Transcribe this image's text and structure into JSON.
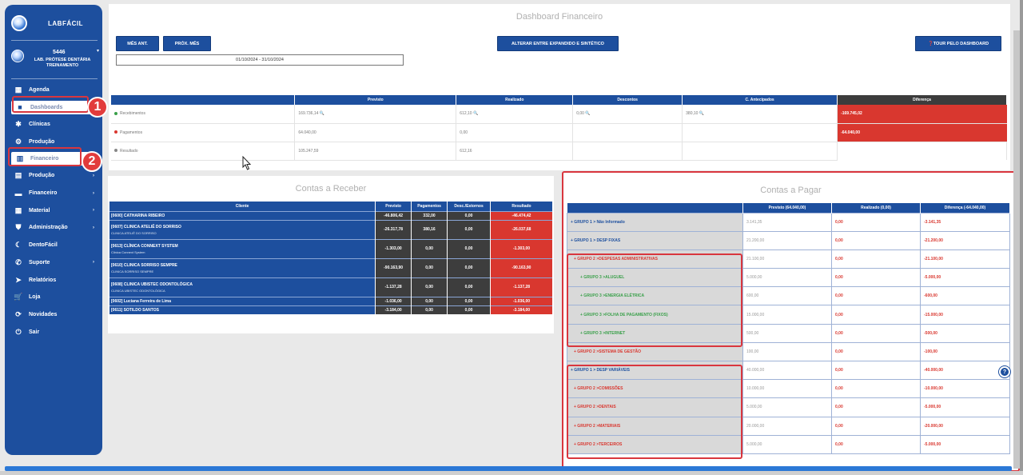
{
  "sidebar": {
    "app_name": "LABFÁCIL",
    "user": {
      "id": "5446",
      "name": "LAB. PRÓTESE DENTÁRIA TREINAMENTO"
    },
    "items": [
      {
        "label": "Agenda",
        "icon": "calendar-icon",
        "glyph": "▦"
      },
      {
        "label": "Dashboards",
        "icon": "grid-icon",
        "glyph": "■"
      },
      {
        "label": "Clínicas",
        "icon": "star-icon",
        "glyph": "✱"
      },
      {
        "label": "Produção",
        "icon": "gear-icon",
        "glyph": "⚙"
      },
      {
        "label": "Financeiro",
        "icon": "building-icon",
        "glyph": "▥"
      },
      {
        "label": "Produção",
        "icon": "chart-icon",
        "glyph": "▤"
      },
      {
        "label": "Financeiro",
        "icon": "money-icon",
        "glyph": "▬"
      },
      {
        "label": "Material",
        "icon": "box-icon",
        "glyph": "▦"
      },
      {
        "label": "Administração",
        "icon": "shield-icon",
        "glyph": "⛊"
      },
      {
        "label": "DentoFácil",
        "icon": "tooth-icon",
        "glyph": "☾"
      },
      {
        "label": "Suporte",
        "icon": "phone-icon",
        "glyph": "✆"
      },
      {
        "label": "Relatórios",
        "icon": "paper-plane-icon",
        "glyph": "➤"
      },
      {
        "label": "Loja",
        "icon": "cart-icon",
        "glyph": "🛒"
      },
      {
        "label": "Novidades",
        "icon": "refresh-icon",
        "glyph": "⟳"
      },
      {
        "label": "Sair",
        "icon": "power-icon",
        "glyph": "⏻"
      }
    ]
  },
  "annotations": {
    "one": "1",
    "two": "2"
  },
  "dashboard": {
    "title": "Dashboard Financeiro",
    "btn_prev": "MÊS ANT.",
    "btn_next": "PRÓX. MÊS",
    "btn_toggle": "ALTERAR ENTRE EXPANDIDO E SINTÉTICO",
    "btn_tour": "❓TOUR PELO DASHBOARD",
    "date_range": "01/10/2024 - 31/10/2024"
  },
  "summary": {
    "headers": [
      "",
      "Previsto",
      "Realizado",
      "Descontos",
      "C. Antecipados",
      "Diferença"
    ],
    "rows": [
      {
        "label": "Recebimentos",
        "dot": "#3aa04a",
        "previsto": "169.736,14",
        "realizado": "612,10",
        "descontos": "0,00",
        "antecipados": "380,10",
        "diferenca": "-169.745,02"
      },
      {
        "label": "Pagamentos",
        "dot": "#d9372f",
        "previsto": "64.040,00",
        "realizado": "0,00",
        "descontos": "",
        "antecipados": "",
        "diferenca": "-64.040,00"
      },
      {
        "label": "Resultado",
        "dot": "#888888",
        "previsto": "105.247,59",
        "realizado": "612,16",
        "descontos": "",
        "antecipados": "",
        "diferenca": ""
      }
    ]
  },
  "receber": {
    "title": "Contas a Receber",
    "headers": [
      "Cliente",
      "Previsto",
      "Pagamentos",
      "Desc./Estornos",
      "Resultado"
    ],
    "rows": [
      {
        "cliente": "[0600] CATHARINA RIBEIRO",
        "sub": "",
        "previsto": "-46.806,42",
        "pagamentos": "332,00",
        "desc": "0,00",
        "resultado": "-46.474,42"
      },
      {
        "cliente": "[0607] CLINICA ATELIÊ DO SORRISO",
        "sub": "CLINICA ATELIÊ DO SORRISO",
        "previsto": "-26.317,78",
        "pagamentos": "380,16",
        "desc": "0,00",
        "resultado": "-26.037,68"
      },
      {
        "cliente": "[0613] CLÍNICA CONNEXT SYSTEM",
        "sub": "Clinica Connext System",
        "previsto": "-1.303,00",
        "pagamentos": "0,00",
        "desc": "0,00",
        "resultado": "-1.303,00"
      },
      {
        "cliente": "[0610] CLINICA SORRISO SEMPRE",
        "sub": "CLINICA SORRISO SEMPRE",
        "previsto": "-90.163,90",
        "pagamentos": "0,00",
        "desc": "0,00",
        "resultado": "-90.163,90"
      },
      {
        "cliente": "[0608] CLINICA UBISTEC ODONTOLÓGICA",
        "sub": "CLINICA UBISTEC ODONTOLÓGICA",
        "previsto": "-1.137,28",
        "pagamentos": "0,00",
        "desc": "0,00",
        "resultado": "-1.137,28"
      },
      {
        "cliente": "[0602] Luciana Ferreira de Lima",
        "sub": "",
        "previsto": "-1.036,00",
        "pagamentos": "0,00",
        "desc": "0,00",
        "resultado": "-1.036,00"
      },
      {
        "cliente": "[0611] SOTILDO SANTOS",
        "sub": "",
        "previsto": "-3.184,00",
        "pagamentos": "0,00",
        "desc": "0,00",
        "resultado": "-3.184,00"
      }
    ]
  },
  "pagar": {
    "title": "Contas a Pagar",
    "headers": [
      "",
      "Previsto (64.040,00)",
      "Realizado (0,00)",
      "Diferença (-64.040,00)"
    ],
    "rows": [
      {
        "grupo": "+ GRUPO 1 > Não Informado",
        "tone": "blue",
        "level": 1,
        "previsto": "3.141,35",
        "realizado": "0,00",
        "diferenca": "-3.141,35"
      },
      {
        "grupo": "+ GRUPO 1 > DESP FIXAS",
        "tone": "blue",
        "level": 1,
        "previsto": "21.200,00",
        "realizado": "0,00",
        "diferenca": "-21.200,00"
      },
      {
        "grupo": "+ GRUPO 2 >DESPESAS ADMINISTRATIVAS",
        "tone": "red",
        "level": 2,
        "previsto": "21.100,00",
        "realizado": "0,00",
        "diferenca": "-21.100,00"
      },
      {
        "grupo": "+ GRUPO 3 >ALUGUEL",
        "tone": "green",
        "level": 3,
        "previsto": "5.000,00",
        "realizado": "0,00",
        "diferenca": "-5.000,00"
      },
      {
        "grupo": "+ GRUPO 3 >ENERGIA ELÉTRICA",
        "tone": "green",
        "level": 3,
        "previsto": "600,00",
        "realizado": "0,00",
        "diferenca": "-600,00"
      },
      {
        "grupo": "+ GRUPO 3 >FOLHA DE PAGAMENTO (FIXOS)",
        "tone": "green",
        "level": 3,
        "previsto": "15.000,00",
        "realizado": "0,00",
        "diferenca": "-15.000,00"
      },
      {
        "grupo": "+ GRUPO 3 >INTERNET",
        "tone": "green",
        "level": 3,
        "previsto": "500,00",
        "realizado": "0,00",
        "diferenca": "-500,00"
      },
      {
        "grupo": "+ GRUPO 2 >SISTEMA DE GESTÃO",
        "tone": "red",
        "level": 2,
        "previsto": "100,00",
        "realizado": "0,00",
        "diferenca": "-100,00"
      },
      {
        "grupo": "+ GRUPO 1 > DESP VARIÁVEIS",
        "tone": "blue",
        "level": 1,
        "previsto": "40.000,00",
        "realizado": "0,00",
        "diferenca": "-40.000,00"
      },
      {
        "grupo": "+ GRUPO 2 >COMISSÕES",
        "tone": "red",
        "level": 2,
        "previsto": "10.000,00",
        "realizado": "0,00",
        "diferenca": "-10.000,00"
      },
      {
        "grupo": "+ GRUPO 2 >DENTAIS",
        "tone": "red",
        "level": 2,
        "previsto": "5.000,00",
        "realizado": "0,00",
        "diferenca": "-5.000,00"
      },
      {
        "grupo": "+ GRUPO 2 >MATERIAIS",
        "tone": "red",
        "level": 2,
        "previsto": "20.000,00",
        "realizado": "0,00",
        "diferenca": "-20.000,00"
      },
      {
        "grupo": "+ GRUPO 2 >TERCEIROS",
        "tone": "red",
        "level": 2,
        "previsto": "5.000,00",
        "realizado": "0,00",
        "diferenca": "-5.000,00"
      }
    ]
  },
  "help_label": "?",
  "colors": {
    "primary": "#1d4f9e",
    "danger": "#d9372f",
    "dark": "#3c3c3c",
    "success": "#3aa04a",
    "annotation": "#e23c3c"
  }
}
